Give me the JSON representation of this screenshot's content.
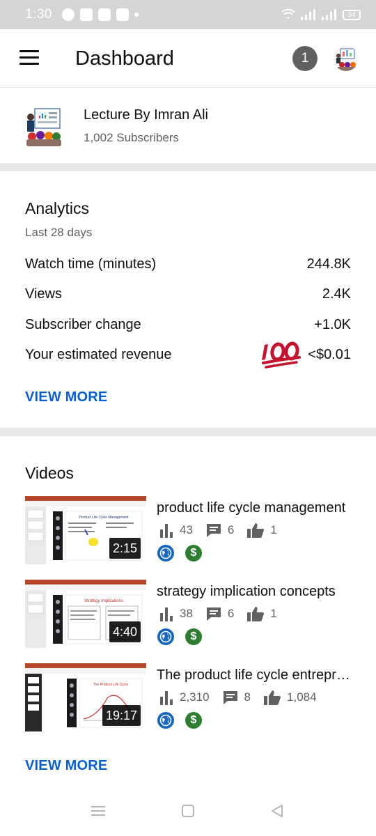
{
  "status_bar": {
    "time": "1:30",
    "battery": "34"
  },
  "app_bar": {
    "title": "Dashboard",
    "notification_count": "1"
  },
  "channel": {
    "name": "Lecture By Imran Ali",
    "subscribers": "1,002 Subscribers"
  },
  "analytics": {
    "title": "Analytics",
    "period": "Last 28 days",
    "metrics": [
      {
        "label": "Watch time (minutes)",
        "value": "244.8K"
      },
      {
        "label": "Views",
        "value": "2.4K"
      },
      {
        "label": "Subscriber change",
        "value": "+1.0K"
      },
      {
        "label": "Your estimated revenue",
        "value": "<$0.01"
      }
    ],
    "view_more": "VIEW MORE"
  },
  "videos": {
    "title": "Videos",
    "items": [
      {
        "title": "product life cycle management",
        "duration": "2:15",
        "views": "43",
        "comments": "6",
        "likes": "1",
        "thumb_heading": "Product Life Cycle Management"
      },
      {
        "title": "strategy implication concepts",
        "duration": "4:40",
        "views": "38",
        "comments": "6",
        "likes": "1",
        "thumb_heading": "Strategy Implications"
      },
      {
        "title": "The product life cycle entrepreneurship",
        "duration": "19:17",
        "views": "2,310",
        "comments": "8",
        "likes": "1,084",
        "thumb_heading": "The Product Life Cycle"
      }
    ],
    "view_more": "VIEW MORE"
  },
  "icons": {
    "menu": "hamburger-menu-icon",
    "hundred": "hundred-points-emoji",
    "views": "bar-chart-icon",
    "comments": "comment-icon",
    "likes": "thumbs-up-icon",
    "visibility": "globe-icon",
    "monetization": "dollar-icon"
  },
  "colors": {
    "accent": "#065fd4",
    "text_primary": "#0f0f0f",
    "text_secondary": "#606060",
    "globe_badge": "#1565c0",
    "money_badge": "#2e7d32",
    "hundred_red": "#c4122f"
  }
}
